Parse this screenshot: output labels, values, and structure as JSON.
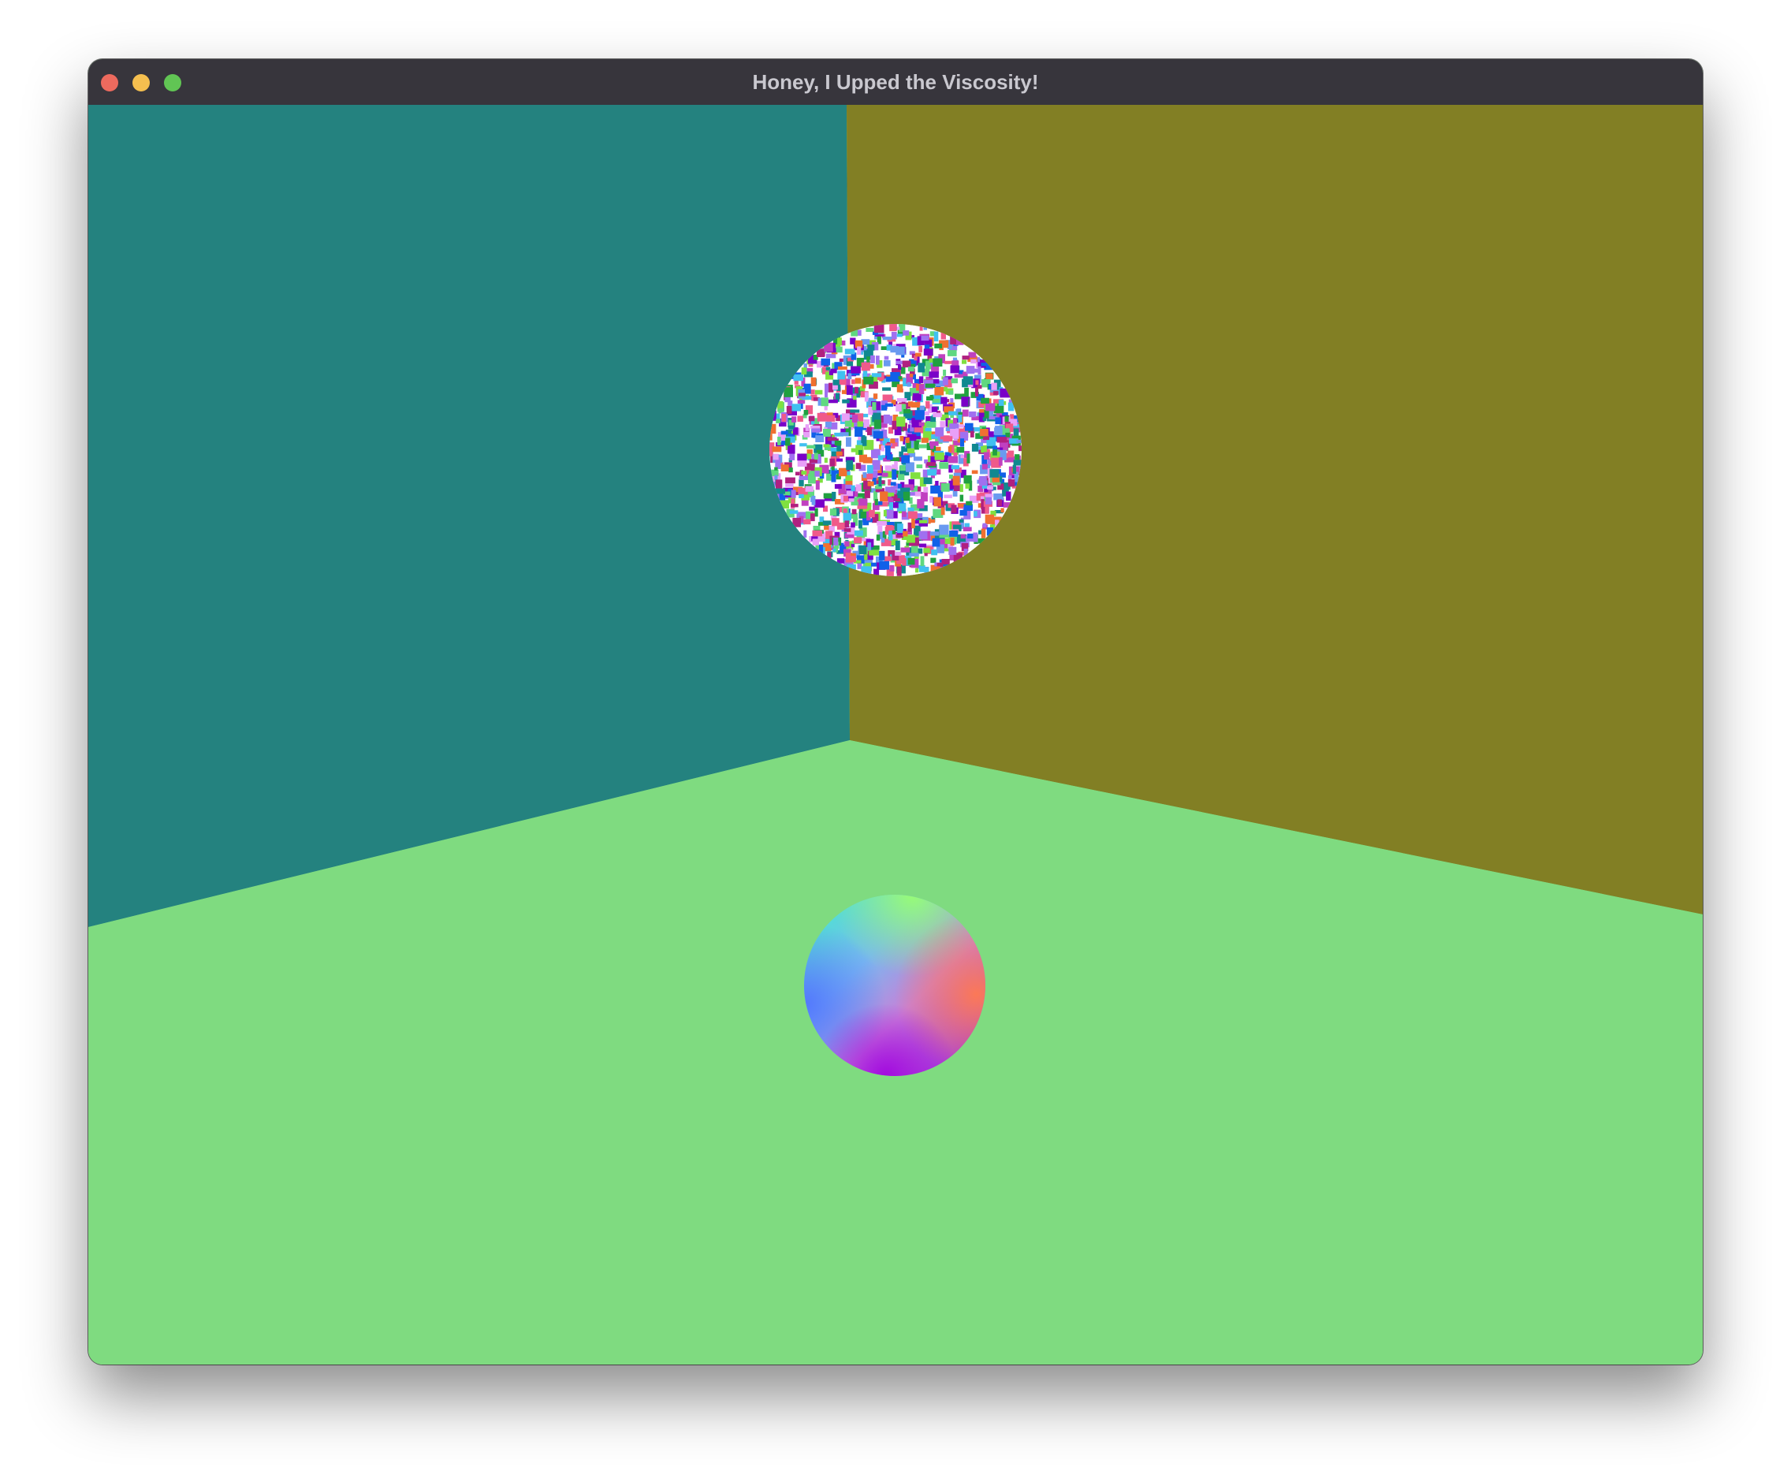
{
  "window": {
    "title": "Honey, I Upped the Viscosity!",
    "controls": [
      "close",
      "minimize",
      "zoom"
    ]
  },
  "scene": {
    "colors": {
      "left_wall": "#24827f",
      "right_wall": "#827f24",
      "floor": "#7fdb80",
      "titlebar": "#37353c",
      "close": "#ed6a5e",
      "minimize": "#f5bf4f",
      "zoom": "#61c554"
    },
    "objects": [
      "noise-textured sphere",
      "normal-shaded sphere"
    ]
  }
}
